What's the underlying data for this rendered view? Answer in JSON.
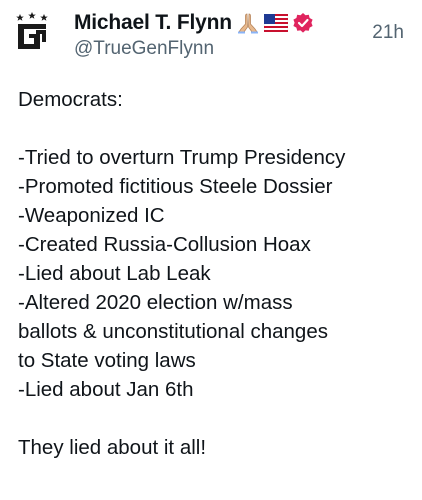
{
  "post": {
    "author": {
      "display_name": "Michael T. Flynn",
      "handle": "@TrueGenFlynn",
      "avatar_icon": "gf-logo-icon",
      "badges": [
        "praying-hands-icon",
        "us-flag-icon",
        "verified-badge-icon"
      ]
    },
    "timestamp": "21h",
    "body": {
      "intro": "Democrats:",
      "items": [
        "-Tried to overturn Trump Presidency",
        "-Promoted fictitious Steele Dossier",
        "-Weaponized IC",
        "-Created Russia-Collusion Hoax",
        "-Lied about Lab Leak",
        "-Altered 2020 election w/mass",
        "ballots & unconstitutional changes",
        "to State voting laws",
        "-Lied about Jan 6th"
      ],
      "closing": "They lied about it all!"
    }
  },
  "colors": {
    "text": "#0f1419",
    "secondary_text": "#536471",
    "verified_badge": "#e0245e"
  }
}
